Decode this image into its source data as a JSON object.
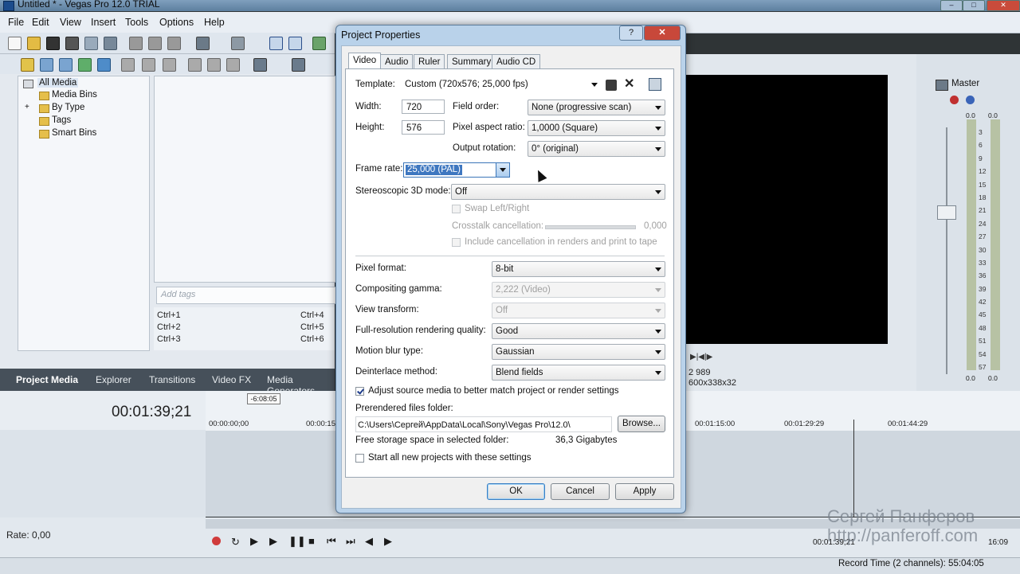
{
  "window": {
    "title": "Untitled * - Vegas Pro 12.0 TRIAL"
  },
  "menu": [
    "File",
    "Edit",
    "View",
    "Insert",
    "Tools",
    "Options",
    "Help"
  ],
  "explorer_tree": [
    "All Media",
    "Media Bins",
    "By Type",
    "Tags",
    "Smart Bins"
  ],
  "tags": {
    "placeholder": "Add tags"
  },
  "shortcuts": [
    "Ctrl+1",
    "Ctrl+2",
    "Ctrl+3",
    "Ctrl+4",
    "Ctrl+5",
    "Ctrl+6"
  ],
  "panel_tabs": [
    "Project Media",
    "Explorer",
    "Transitions",
    "Video FX",
    "Media Generators"
  ],
  "timeline": {
    "timecode": "00:01:39;21",
    "marker": "-6:08:05",
    "ruler": [
      "00:00:00;00",
      "00:00:15",
      "00:01:15:00",
      "00:01:29:29",
      "00:01:44:29"
    ],
    "rate": "Rate: 0,00",
    "cursor_time": "00:01:39;21",
    "end_time": "16:09"
  },
  "preview": {
    "info1": "2 989",
    "info2": "600x338x32"
  },
  "master": {
    "label": "Master",
    "levels": [
      "0.0",
      "0.0"
    ],
    "scale": [
      "3",
      "6",
      "9",
      "12",
      "15",
      "18",
      "21",
      "24",
      "27",
      "30",
      "33",
      "36",
      "39",
      "42",
      "45",
      "48",
      "51",
      "54",
      "57"
    ],
    "bottom_levels": [
      "0.0",
      "0.0"
    ]
  },
  "status": {
    "record_time": "Record Time (2 channels): 55:04:05"
  },
  "watermark": {
    "line1": "Сергей Панферов",
    "line2": "http://panferoff.com"
  },
  "dialog": {
    "title": "Project Properties",
    "help_glyph": "?",
    "close_glyph": "✕",
    "tabs": [
      "Video",
      "Audio",
      "Ruler",
      "Summary",
      "Audio CD"
    ],
    "template_label": "Template:",
    "template_value": "Custom (720x576; 25,000 fps)",
    "width_label": "Width:",
    "width_value": "720",
    "height_label": "Height:",
    "height_value": "576",
    "field_order_label": "Field order:",
    "field_order_value": "None (progressive scan)",
    "par_label": "Pixel aspect ratio:",
    "par_value": "1,0000 (Square)",
    "rotation_label": "Output rotation:",
    "rotation_value": "0° (original)",
    "frame_rate_label": "Frame rate:",
    "frame_rate_value": "25,000 (PAL)",
    "stereo_label": "Stereoscopic 3D mode:",
    "stereo_value": "Off",
    "swap_label": "Swap Left/Right",
    "crosstalk_label": "Crosstalk cancellation:",
    "crosstalk_value": "0,000",
    "include_label": "Include cancellation in renders and print to tape",
    "pixel_format_label": "Pixel format:",
    "pixel_format_value": "8-bit",
    "gamma_label": "Compositing gamma:",
    "gamma_value": "2,222 (Video)",
    "view_transform_label": "View transform:",
    "view_transform_value": "Off",
    "quality_label": "Full-resolution rendering quality:",
    "quality_value": "Good",
    "blur_label": "Motion blur type:",
    "blur_value": "Gaussian",
    "deinterlace_label": "Deinterlace method:",
    "deinterlace_value": "Blend fields",
    "adjust_label": "Adjust source media to better match project or render settings",
    "adjust_checked": true,
    "prerender_label": "Prerendered files folder:",
    "prerender_path": "C:\\Users\\Сергей\\AppData\\Local\\Sony\\Vegas Pro\\12.0\\",
    "browse_label": "Browse...",
    "free_space_label": "Free storage space in selected folder:",
    "free_space_value": "36,3 Gigabytes",
    "start_all_label": "Start all new projects with these settings",
    "ok_label": "OK",
    "cancel_label": "Cancel",
    "apply_label": "Apply"
  }
}
